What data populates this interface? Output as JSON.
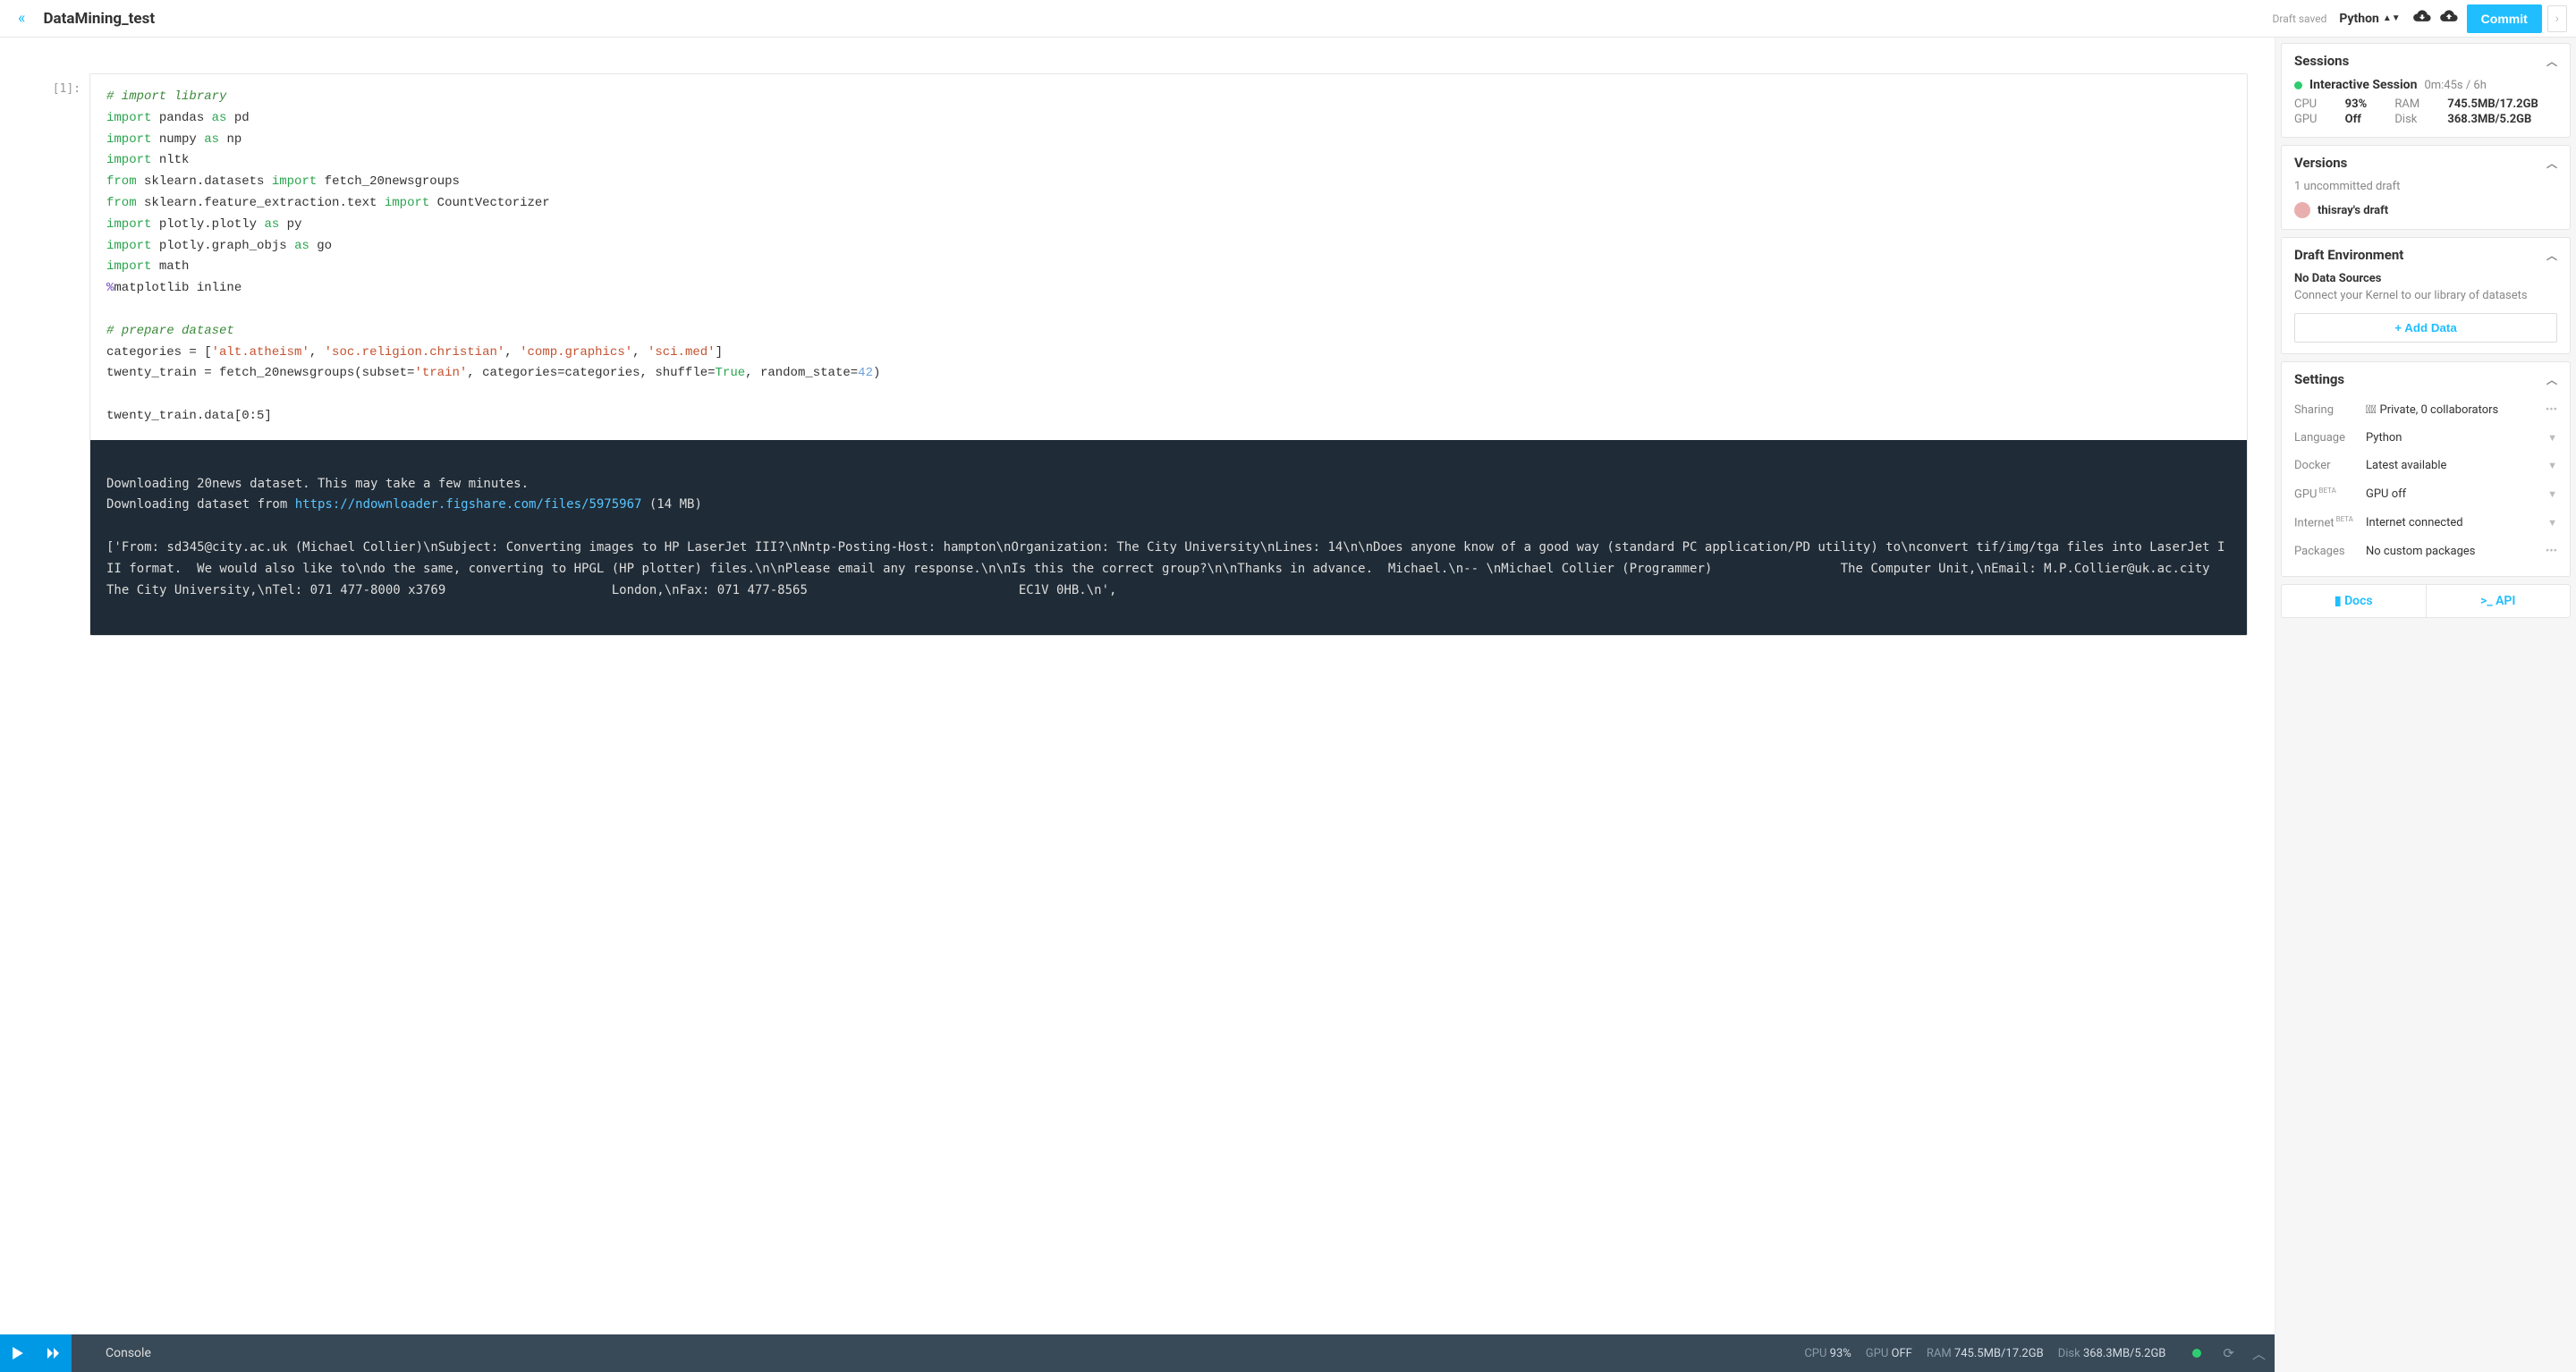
{
  "header": {
    "title": "DataMining_test",
    "draft_saved": "Draft saved",
    "language": "Python",
    "commit": "Commit"
  },
  "cell": {
    "prompt": "[1]:",
    "code_lines": [
      {
        "t": "comment",
        "text": "# import library"
      },
      {
        "t": "imp",
        "kw": "import",
        "mod": " pandas ",
        "as": "as",
        "alias": " pd"
      },
      {
        "t": "imp",
        "kw": "import",
        "mod": " numpy ",
        "as": "as",
        "alias": " np"
      },
      {
        "t": "imp",
        "kw": "import",
        "mod": " nltk"
      },
      {
        "t": "from",
        "kw": "from",
        "mod": " sklearn.datasets ",
        "kw2": "import",
        "rest": " fetch_20newsgroups"
      },
      {
        "t": "from",
        "kw": "from",
        "mod": " sklearn.feature_extraction.text ",
        "kw2": "import",
        "rest": " CountVectorizer"
      },
      {
        "t": "imp",
        "kw": "import",
        "mod": " plotly.plotly ",
        "as": "as",
        "alias": " py"
      },
      {
        "t": "imp",
        "kw": "import",
        "mod": " plotly.graph_objs ",
        "as": "as",
        "alias": " go"
      },
      {
        "t": "imp",
        "kw": "import",
        "mod": " math"
      },
      {
        "t": "magic",
        "text": "%matplotlib inline"
      },
      {
        "t": "blank"
      },
      {
        "t": "comment",
        "text": "# prepare dataset"
      },
      {
        "t": "cats",
        "pre": "categories = [",
        "s1": "'alt.atheism'",
        "s2": "'soc.religion.christian'",
        "s3": "'comp.graphics'",
        "s4": "'sci.med'",
        "post": "]"
      },
      {
        "t": "fetch",
        "pre": "twenty_train = fetch_20newsgroups(subset=",
        "s1": "'train'",
        "mid": ", categories=categories, shuffle=",
        "bool": "True",
        "mid2": ", random_state=",
        "num": "42",
        "post": ")"
      },
      {
        "t": "blank"
      },
      {
        "t": "plain",
        "text": "twenty_train.data[0:5]"
      }
    ],
    "output": {
      "line1": "Downloading 20news dataset. This may take a few minutes.",
      "line2a": "Downloading dataset from ",
      "url": "https://ndownloader.figshare.com/files/5975967",
      "line2b": " (14 MB)",
      "body": "['From: sd345@city.ac.uk (Michael Collier)\\nSubject: Converting images to HP LaserJet III?\\nNntp-Posting-Host: hampton\\nOrganization: The City University\\nLines: 14\\n\\nDoes anyone know of a good way (standard PC application/PD utility) to\\nconvert tif/img/tga files into LaserJet III format.  We would also like to\\ndo the same, converting to HPGL (HP plotter) files.\\n\\nPlease email any response.\\n\\nIs this the correct group?\\n\\nThanks in advance.  Michael.\\n-- \\nMichael Collier (Programmer)                 The Computer Unit,\\nEmail: M.P.Collier@uk.ac.city                The City University,\\nTel: 071 477-8000 x3769                      London,\\nFax: 071 477-8565                            EC1V 0HB.\\n',"
    }
  },
  "console": {
    "label": "Console",
    "cpu_label": "CPU",
    "cpu": "93%",
    "gpu_label": "GPU",
    "gpu": "OFF",
    "ram_label": "RAM",
    "ram": "745.5MB/17.2GB",
    "disk_label": "Disk",
    "disk": "368.3MB/5.2GB"
  },
  "sidebar": {
    "sessions": {
      "title": "Sessions",
      "name": "Interactive Session",
      "time": "0m:45s / 6h",
      "cpu_label": "CPU",
      "cpu": "93%",
      "ram_label": "RAM",
      "ram": "745.5MB/17.2GB",
      "gpu_label": "GPU",
      "gpu": "Off",
      "disk_label": "Disk",
      "disk": "368.3MB/5.2GB"
    },
    "versions": {
      "title": "Versions",
      "sub": "1 uncommitted draft",
      "draft": "thisray's draft"
    },
    "env": {
      "title": "Draft Environment",
      "heading": "No Data Sources",
      "sub": "Connect your Kernel to our library of datasets",
      "add": "+ Add Data"
    },
    "settings": {
      "title": "Settings",
      "sharing_label": "Sharing",
      "sharing": "Private, 0 collaborators",
      "language_label": "Language",
      "language": "Python",
      "docker_label": "Docker",
      "docker": "Latest available",
      "gpu_label": "GPU",
      "gpu": "GPU off",
      "internet_label": "Internet",
      "internet": "Internet connected",
      "packages_label": "Packages",
      "packages": "No custom packages"
    },
    "footer": {
      "docs": "Docs",
      "api": "API"
    }
  }
}
